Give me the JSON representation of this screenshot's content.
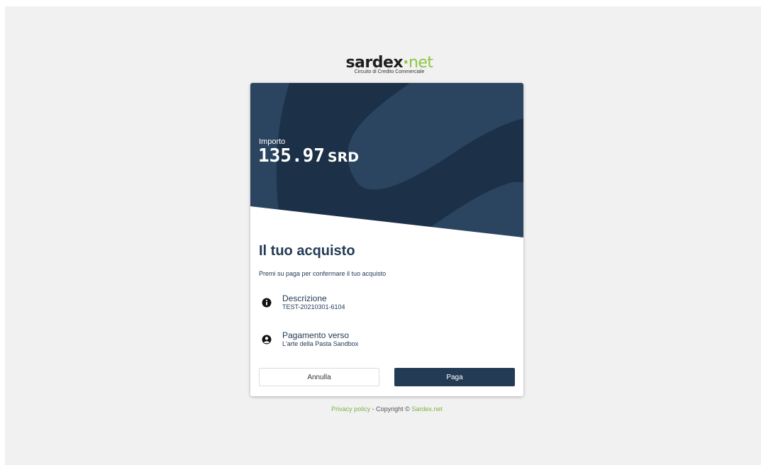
{
  "brand": {
    "name_part1": "sardex",
    "name_dot": "·",
    "name_part2": "net",
    "tagline": "Circuito di Credito Commerciale"
  },
  "payment": {
    "amount_label": "Importo",
    "amount": "135.97",
    "currency": "SRD"
  },
  "purchase": {
    "title": "Il tuo acquisto",
    "subtitle": "Premi su paga per confermare il tuo acquisto",
    "description_label": "Descrizione",
    "description_value": "TEST-20210301-6104",
    "recipient_label": "Pagamento verso",
    "recipient_value": "L'arte della Pasta Sandbox",
    "icons": {
      "description": "info-circle-icon",
      "recipient": "user-circle-icon"
    }
  },
  "actions": {
    "cancel_label": "Annulla",
    "pay_label": "Paga"
  },
  "footer": {
    "privacy_label": "Privacy policy",
    "separator": " - Copyright © ",
    "brand_link": "Sardex.net"
  },
  "colors": {
    "primary": "#233b55",
    "hero_dark": "#1c3048",
    "hero_light": "#2b4561",
    "accent_green": "#8cc63f",
    "background": "#f1f1f1"
  }
}
